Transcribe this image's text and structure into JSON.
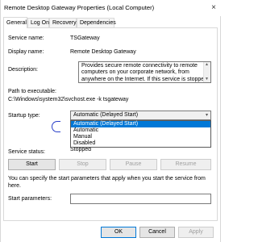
{
  "window": {
    "title": "Remote Desktop Gateway Properties (Local Computer)",
    "close_glyph": "×"
  },
  "tabs": [
    {
      "label": "General",
      "active": true
    },
    {
      "label": "Log On",
      "active": false
    },
    {
      "label": "Recovery",
      "active": false
    },
    {
      "label": "Dependencies",
      "active": false
    }
  ],
  "general": {
    "service_name_label": "Service name:",
    "service_name": "TSGateway",
    "display_name_label": "Display name:",
    "display_name": "Remote Desktop Gateway",
    "description_label": "Description:",
    "description": "Provides secure remote connectivity to remote computers on your corporate network, from anywhere on the Internet. If this service is stopped",
    "path_label": "Path to executable:",
    "path": "C:\\Windows\\system32\\svchost.exe -k tsgateway",
    "startup_type_label": "Startup type:",
    "startup_type_value": "Automatic (Delayed Start)",
    "startup_options": [
      "Automatic (Delayed Start)",
      "Automatic",
      "Manual",
      "Disabled"
    ],
    "service_status_label": "Service status:",
    "service_status": "Stopped",
    "start_label": "Start",
    "stop_label": "Stop",
    "pause_label": "Pause",
    "resume_label": "Resume",
    "hint": "You can specify the start parameters that apply when you start the service from here.",
    "start_params_label": "Start parameters:",
    "start_params_value": ""
  },
  "footer": {
    "ok_label": "OK",
    "cancel_label": "Cancel",
    "apply_label": "Apply"
  }
}
